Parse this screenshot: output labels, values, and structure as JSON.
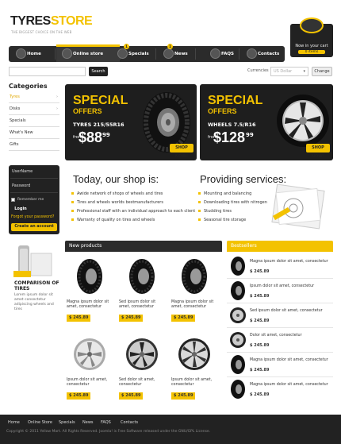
{
  "brand": {
    "logo_part1": "TYRES",
    "logo_part2": "STORE",
    "slogan": "THE BIGGEST CHOICE ON THE WEB"
  },
  "cart": {
    "label": "Now in your cart",
    "items": "0 items"
  },
  "nav": [
    {
      "label": "Home",
      "icon": "home-icon"
    },
    {
      "label": "Online store",
      "icon": "cart-icon"
    },
    {
      "label": "Specials",
      "icon": "tag-icon",
      "badge": "1"
    },
    {
      "label": "News",
      "icon": "news-icon",
      "badge": "1"
    },
    {
      "label": "FAQS",
      "icon": "question-icon"
    },
    {
      "label": "Contacts",
      "icon": "person-icon"
    }
  ],
  "search": {
    "placeholder": "",
    "button": "Search"
  },
  "currency": {
    "label": "Currencies",
    "selected": "US Dollar",
    "button": "Change"
  },
  "categories": {
    "title": "Categories",
    "items": [
      "Tyres",
      "Disks",
      "Specials",
      "What's New",
      "Gifts"
    ]
  },
  "banners": [
    {
      "special": "SPECIAL",
      "offers": "OFFERS",
      "name": "TYRES 215/55R16",
      "from": "from",
      "price": "88",
      "cents": "99",
      "button": "SHOP NOW!"
    },
    {
      "special": "SPECIAL",
      "offers": "OFFERS",
      "name": "WHEELS 7.5/R16",
      "from": "from",
      "price": "128",
      "cents": "99",
      "button": "SHOP NOW!"
    }
  ],
  "login": {
    "username": "UserName",
    "password": "Password",
    "remember": "Remember me",
    "button": "Login",
    "forgot": "Forgot your password?",
    "create": "Create an account"
  },
  "today": {
    "title": "Today, our shop is:",
    "items": [
      "Awide network of shops of wheels and tires",
      "Tires and wheels worlds bestmanufacturers",
      "Professional staff with an individual approach to each client",
      "Warranty of quality on tires and wheels"
    ]
  },
  "services": {
    "title": "Providing services:",
    "items": [
      "Mounting and balancing",
      "Downloading tires with nitrogen",
      "Studding tires",
      "Seasonal tire storage"
    ]
  },
  "compare": {
    "title": "COMPARISON OF TIRES",
    "text": "Lorem ipsum dolor sit amet consectetur adipiscing wheels and tires"
  },
  "new_products": {
    "title": "New products",
    "items": [
      {
        "name": "Magna ipsum dolor sit amet, consectetur",
        "price": "$ 245.89"
      },
      {
        "name": "Sed ipsum dolor sit amet, consectetur",
        "price": "$ 245.89"
      },
      {
        "name": "Magna ipsum dolor sit amet, consectetur",
        "price": "$ 245.89"
      },
      {
        "name": "Ipsum dolor sit amet, consectetur",
        "price": "$ 245.89"
      },
      {
        "name": "Sed dolor sit amet, consectetur",
        "price": "$ 245.89"
      },
      {
        "name": "Ipsum dolor sit amet, consectetur",
        "price": "$ 245.89"
      }
    ]
  },
  "bestsellers": {
    "title": "Bestsellers",
    "items": [
      {
        "name": "Magna ipsum dolor sit amet, consectetur",
        "price": "$ 245.89"
      },
      {
        "name": "Ipsum dolor sit amet, consectetur",
        "price": "$ 245.89"
      },
      {
        "name": "Sed ipsum dolor sit amet, consectetur",
        "price": "$ 245.89"
      },
      {
        "name": "Dolor sit amet, consectetur",
        "price": "$ 245.89"
      },
      {
        "name": "Magna ipsum dolor sit amet, consectetur",
        "price": "$ 245.89"
      },
      {
        "name": "Magna ipsum dolor sit amet, consectetur",
        "price": "$ 245.89"
      }
    ]
  },
  "footer": {
    "links": [
      "Home",
      "Online Store",
      "Specials",
      "News",
      "FAQS",
      "Contacts"
    ],
    "copyright": "Copyright © 2011 Yellow Mart. All Rights Reserved. Joomla! is Free Software released under the GNU/GPL License."
  },
  "colors": {
    "accent": "#f3c200",
    "dark": "#222222",
    "new_header": "#2b2b2b",
    "best_header": "#f3c200"
  }
}
